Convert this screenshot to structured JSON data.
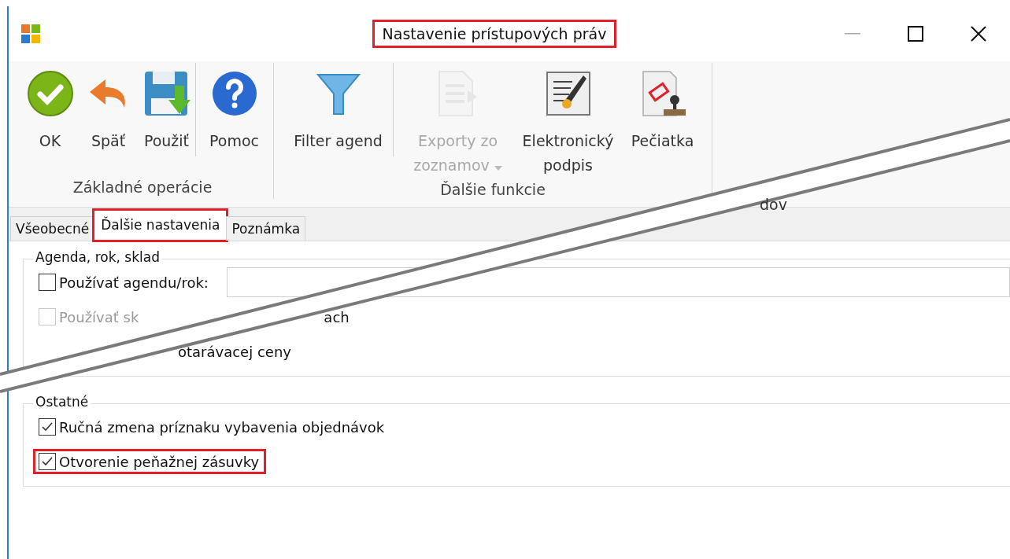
{
  "window": {
    "title": "Nastavenie prístupových práv",
    "title_highlighted": true
  },
  "ribbon": {
    "groups": [
      {
        "label": "Základné operácie",
        "buttons": [
          {
            "kind": "ok",
            "label": "OK",
            "disabled": false,
            "has_menu": false,
            "separator_after": false
          },
          {
            "kind": "back",
            "label": "Späť",
            "disabled": false,
            "has_menu": false,
            "separator_after": false
          },
          {
            "kind": "save",
            "label": "Použiť",
            "disabled": false,
            "has_menu": false,
            "separator_after": true
          },
          {
            "kind": "help",
            "label": "Pomoc",
            "disabled": false,
            "has_menu": false,
            "separator_after": false
          }
        ]
      },
      {
        "label": "Ďalšie funkcie",
        "buttons": [
          {
            "kind": "filter",
            "label": "Filter agend",
            "disabled": false,
            "has_menu": false,
            "separator_after": true
          },
          {
            "kind": "export",
            "label": "Exporty zo zoznamov",
            "disabled": true,
            "has_menu": true,
            "separator_after": false
          },
          {
            "kind": "signature",
            "label": "Elektronický podpis",
            "disabled": false,
            "has_menu": false,
            "separator_after": false
          },
          {
            "kind": "stamp",
            "label": "Pečiatka",
            "disabled": false,
            "has_menu": false,
            "separator_after": false
          }
        ]
      }
    ],
    "fragment": "dov"
  },
  "tabs": [
    {
      "label": "Všeobecné",
      "selected": false,
      "highlighted": false
    },
    {
      "label": "Ďalšie nastavenia",
      "selected": true,
      "highlighted": true
    },
    {
      "label": "Poznámka",
      "selected": false,
      "highlighted": false
    }
  ],
  "groups": [
    {
      "title": "Agenda, rok, sklad",
      "items": [
        {
          "kind": "checkbox_field",
          "label": "Používať agendu/rok:",
          "checked": false,
          "disabled": false,
          "highlighted": false
        },
        {
          "kind": "checkbox",
          "label": "Používať sk",
          "checked": false,
          "disabled": true,
          "highlighted": false,
          "trailing": "ach"
        },
        {
          "kind": "text",
          "label": "otarávacej ceny"
        }
      ]
    },
    {
      "title": "Ostatné",
      "items": [
        {
          "kind": "checkbox",
          "label": "Ručná zmena príznaku vybavenia objednávok",
          "checked": true,
          "disabled": false,
          "highlighted": false
        },
        {
          "kind": "checkbox",
          "label": "Otvorenie peňažnej zásuvky",
          "checked": true,
          "disabled": false,
          "highlighted": true
        }
      ]
    }
  ]
}
